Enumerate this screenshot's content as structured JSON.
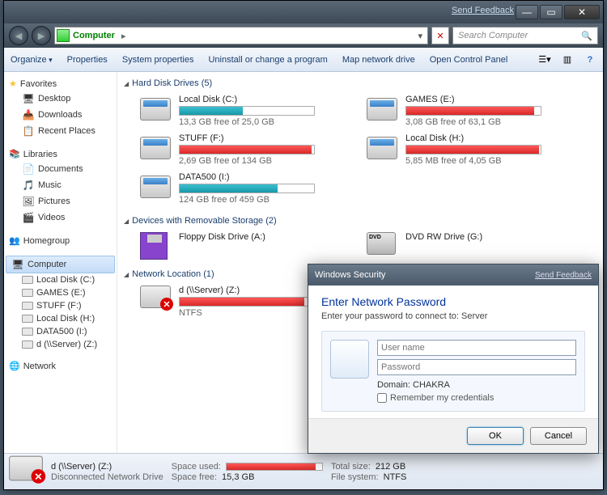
{
  "titlebar": {
    "send_feedback": "Send Feedback"
  },
  "nav": {
    "address": "Computer",
    "arrow": "▸",
    "search_placeholder": "Search Computer"
  },
  "toolbar": {
    "organize": "Organize",
    "properties": "Properties",
    "sysprops": "System properties",
    "uninstall": "Uninstall or change a program",
    "mapdrive": "Map network drive",
    "controlpanel": "Open Control Panel"
  },
  "sidebar": {
    "favorites": "Favorites",
    "fav_items": [
      "Desktop",
      "Downloads",
      "Recent Places"
    ],
    "libraries": "Libraries",
    "lib_items": [
      "Documents",
      "Music",
      "Pictures",
      "Videos"
    ],
    "homegroup": "Homegroup",
    "computer": "Computer",
    "drives": [
      "Local Disk (C:)",
      "GAMES (E:)",
      "STUFF (F:)",
      "Local Disk (H:)",
      "DATA500 (I:)",
      "d (\\\\Server) (Z:)"
    ],
    "network": "Network"
  },
  "sections": {
    "hdd": "Hard Disk Drives (5)",
    "removable": "Devices with Removable Storage (2)",
    "netloc": "Network Location (1)"
  },
  "drives": {
    "c": {
      "name": "Local Disk (C:)",
      "free": "13,3 GB free of 25,0 GB",
      "pct": 47,
      "color": "teal"
    },
    "e": {
      "name": "GAMES (E:)",
      "free": "3,08 GB free of 63,1 GB",
      "pct": 95,
      "color": "red"
    },
    "f": {
      "name": "STUFF (F:)",
      "free": "2,69 GB free of 134 GB",
      "pct": 98,
      "color": "red"
    },
    "h": {
      "name": "Local Disk (H:)",
      "free": "5,85 MB free of 4,05 GB",
      "pct": 99,
      "color": "red"
    },
    "i": {
      "name": "DATA500 (I:)",
      "free": "124 GB free of 459 GB",
      "pct": 73,
      "color": "teal"
    },
    "a": {
      "name": "Floppy Disk Drive (A:)"
    },
    "g": {
      "name": "DVD RW Drive (G:)"
    },
    "z": {
      "name": "d (\\\\Server) (Z:)",
      "fs": "NTFS",
      "pct": 93,
      "color": "red"
    }
  },
  "statusbar": {
    "name": "d (\\\\Server) (Z:)",
    "type": "Disconnected Network Drive",
    "space_used_label": "Space used:",
    "space_free_label": "Space free:",
    "space_free": "15,3 GB",
    "total_label": "Total size:",
    "total": "212 GB",
    "fs_label": "File system:",
    "fs": "NTFS"
  },
  "dialog": {
    "title": "Windows Security",
    "send_feedback": "Send Feedback",
    "heading": "Enter Network Password",
    "sub": "Enter your password to connect to: Server",
    "user_ph": "User name",
    "pass_ph": "Password",
    "domain_label": "Domain: CHAKRA",
    "remember": "Remember my credentials",
    "ok": "OK",
    "cancel": "Cancel"
  }
}
